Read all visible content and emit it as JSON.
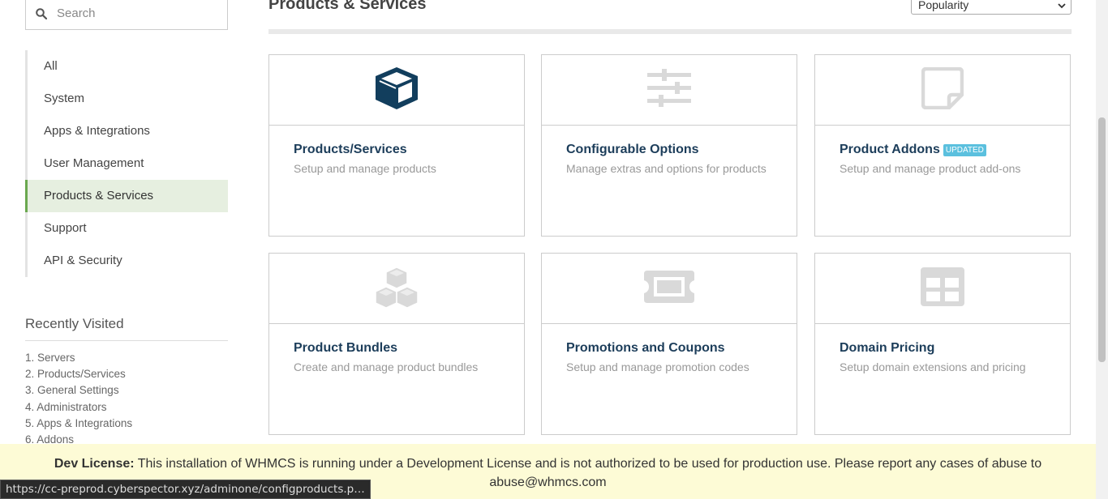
{
  "search": {
    "placeholder": "Search"
  },
  "categories": [
    {
      "label": "All"
    },
    {
      "label": "System"
    },
    {
      "label": "Apps & Integrations"
    },
    {
      "label": "User Management"
    },
    {
      "label": "Products & Services",
      "active": true
    },
    {
      "label": "Support"
    },
    {
      "label": "API & Security"
    }
  ],
  "recently_visited": {
    "title": "Recently Visited",
    "items": [
      "1. Servers",
      "2. Products/Services",
      "3. General Settings",
      "4. Administrators",
      "5. Apps & Integrations",
      "6. Addons"
    ]
  },
  "main": {
    "title": "Products & Services",
    "sort_value": "Popularity"
  },
  "cards": [
    {
      "title": "Products/Services",
      "desc": "Setup and manage products",
      "icon": "cube-icon",
      "icon_color": "#123e5d"
    },
    {
      "title": "Configurable Options",
      "desc": "Manage extras and options for products",
      "icon": "sliders-icon",
      "icon_color": "#d9d9d9"
    },
    {
      "title": "Product Addons",
      "badge": "UPDATED",
      "desc": "Setup and manage product add-ons",
      "icon": "sticky-note-icon",
      "icon_color": "#d9d9d9"
    },
    {
      "title": "Product Bundles",
      "desc": "Create and manage product bundles",
      "icon": "cubes-icon",
      "icon_color": "#d9d9d9"
    },
    {
      "title": "Promotions and Coupons",
      "desc": "Setup and manage promotion codes",
      "icon": "ticket-icon",
      "icon_color": "#d9d9d9"
    },
    {
      "title": "Domain Pricing",
      "desc": "Setup domain extensions and pricing",
      "icon": "table-icon",
      "icon_color": "#d9d9d9"
    }
  ],
  "notice": {
    "label": "Dev License:",
    "text": "This installation of WHMCS is running under a Development License and is not authorized to be used for production use. Please report any cases of abuse to abuse@whmcs.com"
  },
  "status_url": "https://cc-preprod.cyberspector.xyz/adminone/configproducts.p…"
}
